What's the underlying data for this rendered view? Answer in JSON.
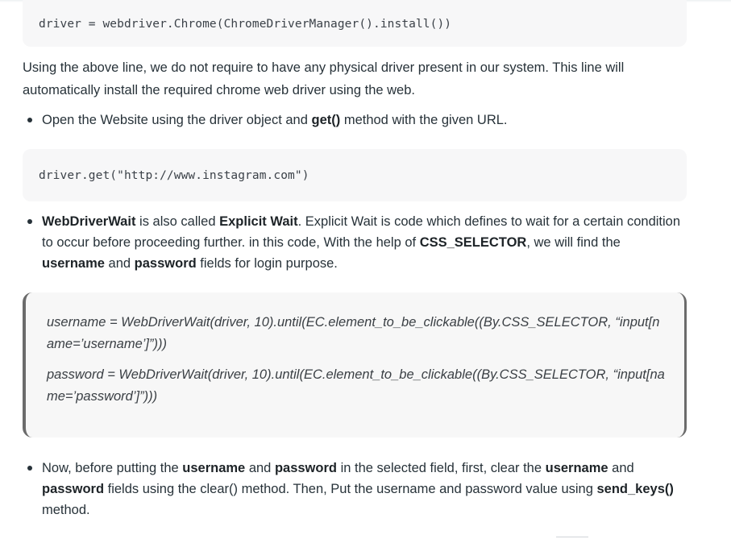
{
  "code1": "driver = webdriver.Chrome(ChromeDriverManager().install())",
  "para1": "Using the above line, we do not require to have any physical driver present in our system. This line will automatically install the required chrome web driver using the web.",
  "bullet1": {
    "t1": "Open the Website using the driver object and ",
    "b1": "get()",
    "t2": " method with the given URL."
  },
  "code2": "driver.get(\"http://www.instagram.com\")",
  "bullet2": {
    "b1": "WebDriverWait",
    "t1": " is also called ",
    "b2": "Explicit Wait",
    "t2": ". Explicit Wait is code which defines to wait for a certain condition to occur before proceeding further. in this code, With the help of ",
    "b3": "CSS_SELECTOR",
    "t3": ", we will find the ",
    "b4": "username",
    "t4": " and ",
    "b5": "password",
    "t5": " fields for login purpose."
  },
  "quote": {
    "line1": "username = WebDriverWait(driver, 10).until(EC.element_to_be_clickable((By.CSS_SELECTOR, “input[name=’username’]”)))",
    "line2": "password = WebDriverWait(driver, 10).until(EC.element_to_be_clickable((By.CSS_SELECTOR, “input[name=’password’]”)))"
  },
  "bullet3": {
    "t1": "Now, before putting the ",
    "b1": "username",
    "t2": " and ",
    "b2": "password",
    "t3": " in the selected field, first, clear the ",
    "b3": "username",
    "t4": " and ",
    "b4": "password",
    "t5": " fields using the clear() method. Then, Put the username and password value using ",
    "b5": "send_keys()",
    "t6": " method."
  }
}
